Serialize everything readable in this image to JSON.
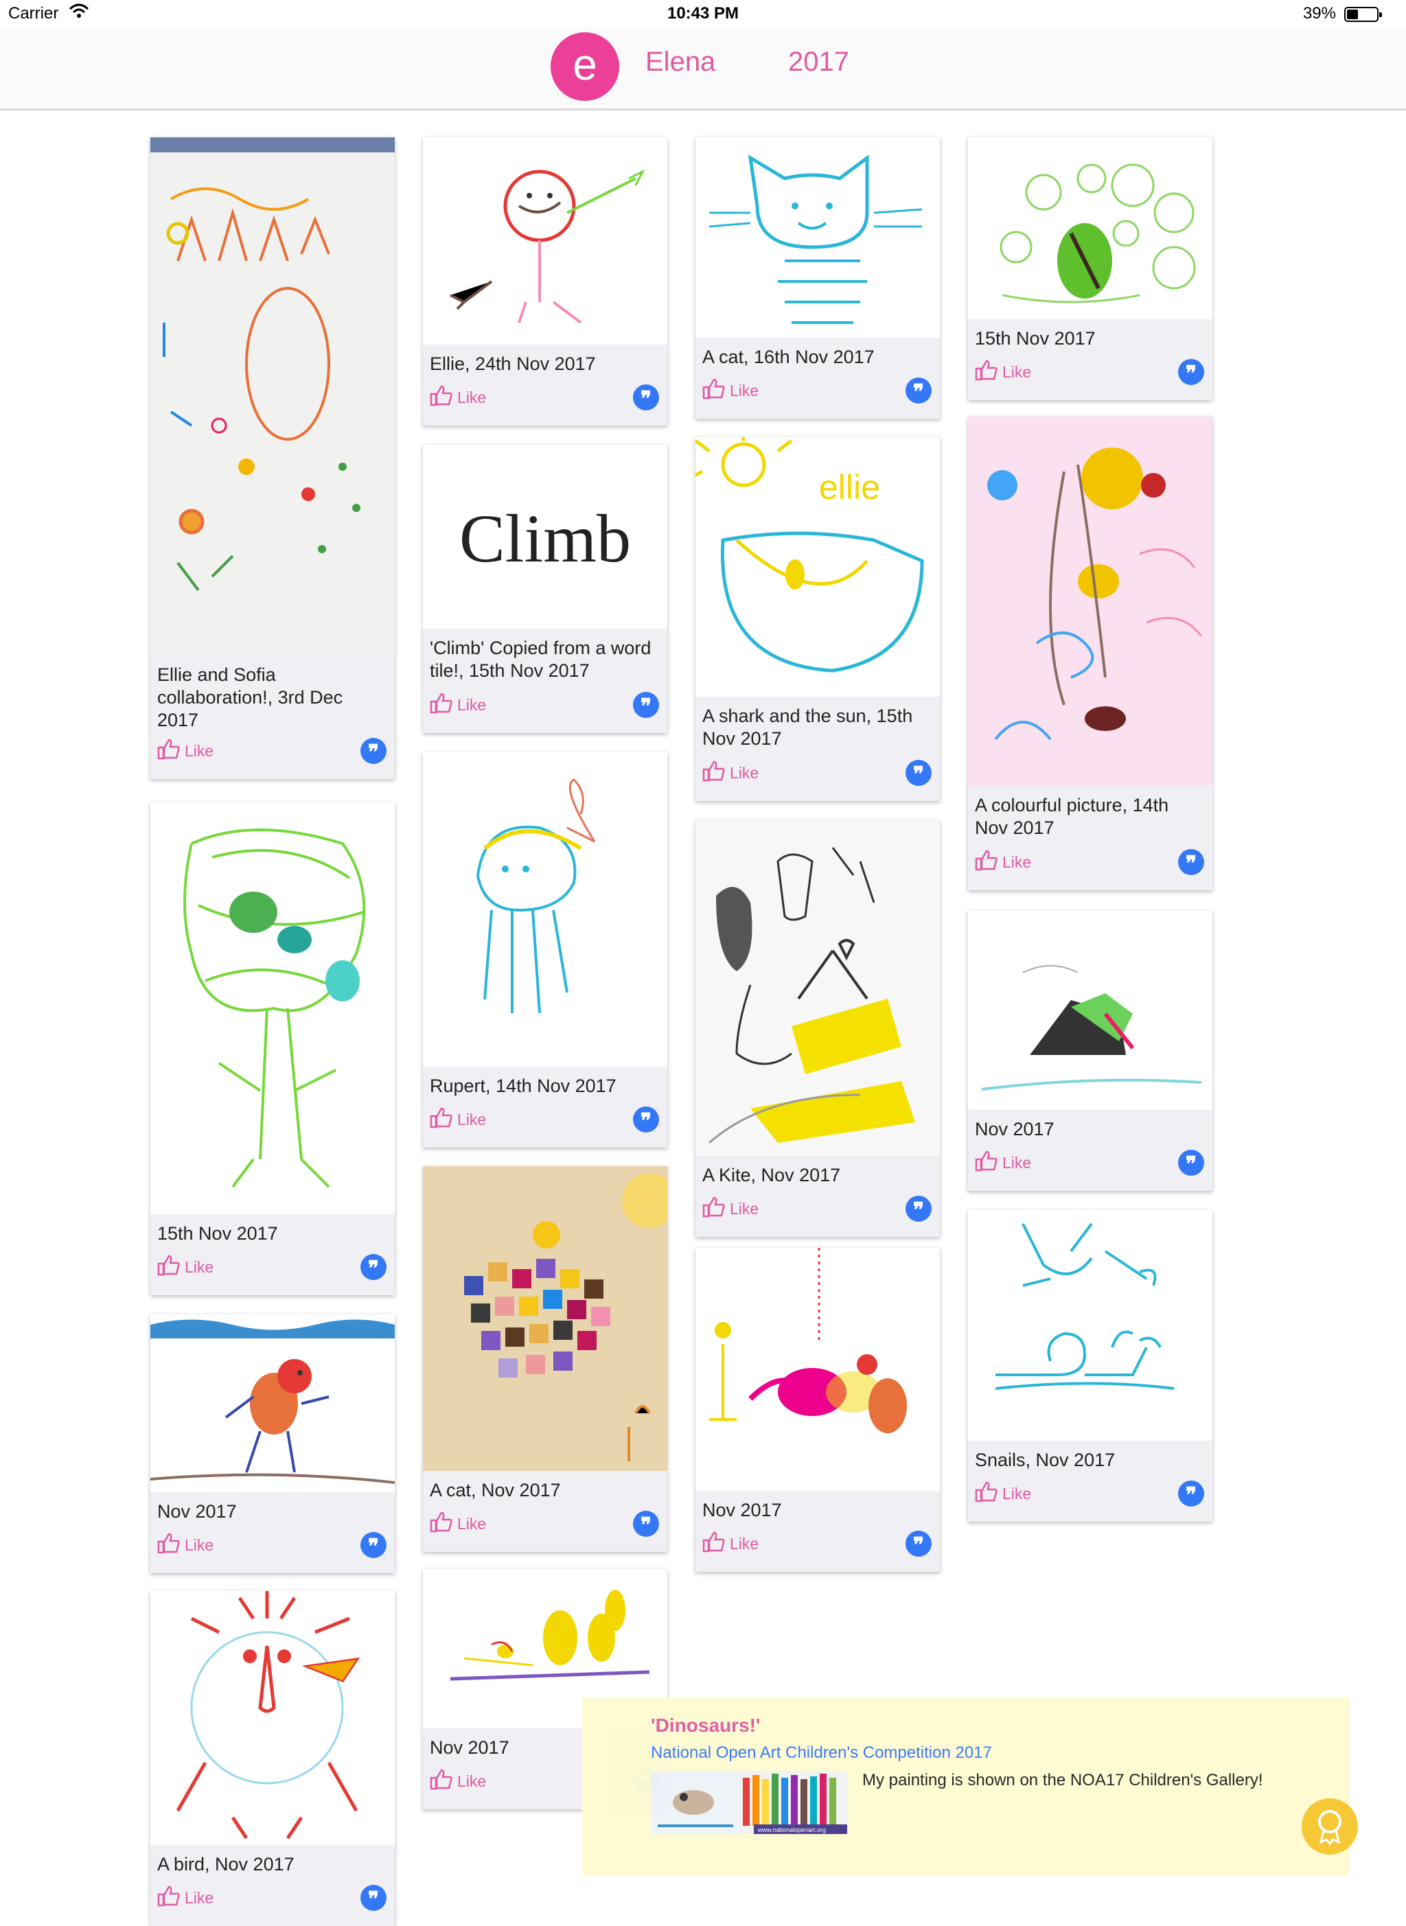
{
  "status_bar": {
    "carrier": "Carrier",
    "time": "10:43 PM",
    "battery": "39%"
  },
  "header": {
    "avatar_letter": "e",
    "name": "Elena",
    "year": "2017"
  },
  "like_label": "Like",
  "comment_glyph": "❞",
  "cards": [
    {
      "caption": "Ellie and Sofia collaboration!, 3rd Dec 2017",
      "artwork": "abstract letters drawing"
    },
    {
      "caption": "Ellie, 24th Nov 2017",
      "artwork": "stick figure drawing"
    },
    {
      "caption": "A cat, 16th Nov 2017",
      "artwork": "cat drawing"
    },
    {
      "caption": "15th Nov 2017",
      "artwork": "green circles drawing"
    },
    {
      "caption": "'Climb' Copied from a word tile!, 15th Nov 2017",
      "artwork": "Climb",
      "word": "Climb"
    },
    {
      "caption": "A shark and the sun, 15th Nov 2017",
      "artwork": "shark and sun drawing"
    },
    {
      "caption": "A colourful picture, 14th Nov 2017",
      "artwork": "colourful scribble drawing"
    },
    {
      "caption": "15th Nov 2017",
      "artwork": "green scribble drawing"
    },
    {
      "caption": "Rupert, 14th Nov 2017",
      "artwork": "jellyfish drawing"
    },
    {
      "caption": "A Kite, Nov 2017",
      "artwork": "kite drawing"
    },
    {
      "caption": "Nov 2017",
      "artwork": "crayon blob drawing"
    },
    {
      "caption": "A cat, Nov 2017",
      "artwork": "mosaic collage"
    },
    {
      "caption": "Nov 2017",
      "artwork": "bird with sea drawing"
    },
    {
      "caption": "Nov 2017",
      "artwork": "pink bird drawing"
    },
    {
      "caption": "Snails, Nov 2017",
      "artwork": "snails drawing"
    },
    {
      "caption": "Nov 2017",
      "artwork": "ducks drawing"
    },
    {
      "caption": "A bird, Nov 2017",
      "artwork": "red bird drawing"
    }
  ],
  "banner": {
    "title": "'Dinosaurs!'",
    "subtitle": "National Open Art Children's Competition 2017",
    "description": "My painting is shown on the NOA17 Children's Gallery!",
    "thumbnail_text": "www.nationalopenart.org"
  },
  "colors": {
    "accent_pink": "#e05aa3",
    "avatar_pink": "#ec3f97",
    "comment_blue": "#3478f6",
    "banner_bg": "#fefbd2",
    "award_yellow": "#f7c72f"
  }
}
